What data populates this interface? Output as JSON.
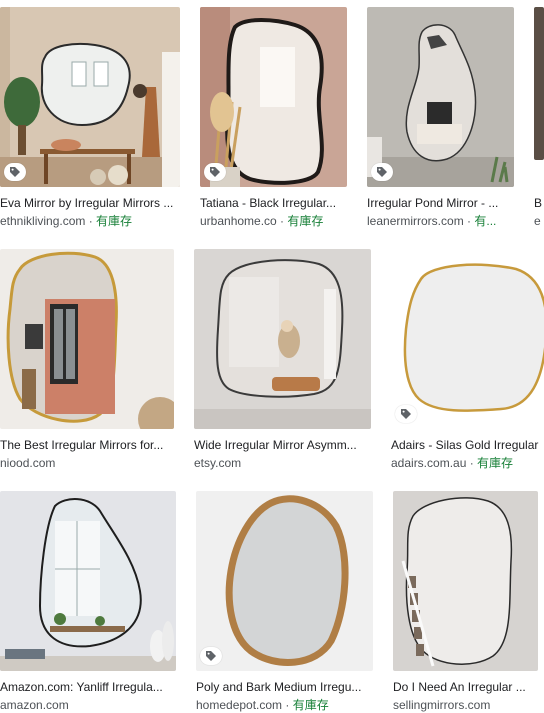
{
  "colors": {
    "title_text": "#202124",
    "source_text": "#4d5156",
    "in_stock": "#188038"
  },
  "results": [
    {
      "title": "Eva Mirror by Irregular Mirrors ...",
      "source": "ethnikliving.com",
      "stock": "有庫存",
      "separator": " · ",
      "tag_icon": "shopping-tag-icon"
    },
    {
      "title": "Tatiana - Black Irregular...",
      "source": "urbanhome.co",
      "stock": "有庫存",
      "separator": " · ",
      "tag_icon": "shopping-tag-icon"
    },
    {
      "title": "Irregular Pond Mirror - ...",
      "source": "leanermirrors.com",
      "stock": "有...",
      "separator": " · ",
      "tag_icon": "shopping-tag-icon"
    },
    {
      "title": "B",
      "source": "e",
      "stock": "",
      "separator": "",
      "tag_icon": ""
    },
    {
      "title": "The Best Irregular Mirrors for...",
      "source": "niood.com",
      "stock": "",
      "separator": "",
      "tag_icon": ""
    },
    {
      "title": "Wide Irregular Mirror Asymm...",
      "source": "etsy.com",
      "stock": "",
      "separator": "",
      "tag_icon": ""
    },
    {
      "title": "Adairs - Silas Gold Irregular",
      "source": "adairs.com.au",
      "stock": "有庫存",
      "separator": " · ",
      "tag_icon": "shopping-tag-icon"
    },
    {
      "title": "Amazon.com: Yanliff Irregula...",
      "source": "amazon.com",
      "stock": "",
      "separator": "",
      "tag_icon": ""
    },
    {
      "title": "Poly and Bark Medium Irregu...",
      "source": "homedepot.com",
      "stock": "有庫存",
      "separator": " · ",
      "tag_icon": "shopping-tag-icon"
    },
    {
      "title": "Do I Need An Irregular ...",
      "source": "sellingmirrors.com",
      "stock": "",
      "separator": "",
      "tag_icon": ""
    }
  ]
}
